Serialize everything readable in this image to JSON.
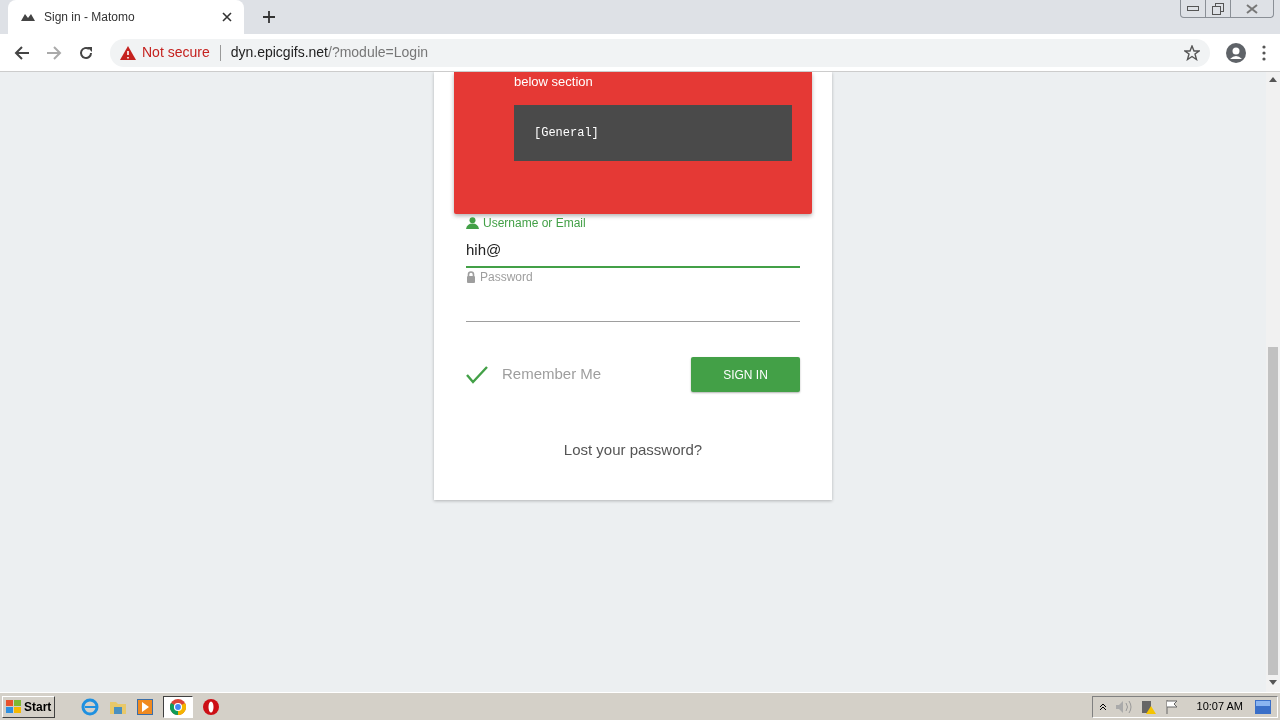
{
  "browser": {
    "tab": {
      "title": "Sign in - Matomo",
      "selected": true
    },
    "security": "Not secure",
    "url_host": "dyn.epicgifs.net",
    "url_path": "/?module=Login"
  },
  "error": {
    "text": "below section",
    "code": "[General]"
  },
  "fields": [
    {
      "kind": "text",
      "label": "Username or Email",
      "value": "hih@",
      "focused": true
    },
    {
      "kind": "password",
      "label": "Password",
      "focused": false
    }
  ],
  "remember": {
    "label": "Remember Me",
    "checked": true
  },
  "sign_in": "SIGN IN",
  "lost_password": "Lost your password?",
  "taskbar": {
    "start": "Start",
    "clock": "10:07 AM"
  }
}
